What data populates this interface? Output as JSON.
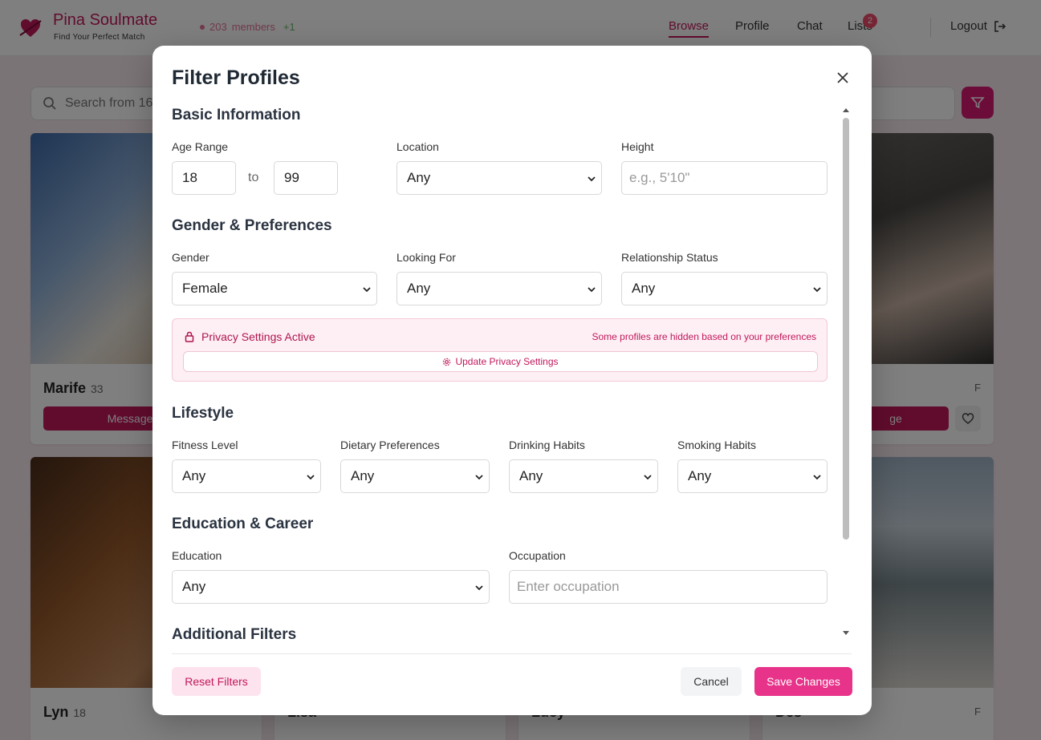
{
  "app": {
    "brand_name": "Pina Soulmate",
    "brand_tagline": "Find Your Perfect Match",
    "members_count": "203",
    "members_label": "members",
    "members_delta": "+1"
  },
  "nav": {
    "browse": "Browse",
    "profile": "Profile",
    "chat": "Chat",
    "lists": "Lists",
    "lists_badge": "2",
    "logout": "Logout"
  },
  "search": {
    "placeholder": "Search from 16"
  },
  "cards": [
    {
      "name": "Marife",
      "age": "33",
      "message": "Message"
    },
    {
      "name": "",
      "age": "",
      "gender": "F",
      "message": "ge"
    },
    {
      "name": "Lyn",
      "age": "18"
    },
    {
      "name": "Lisa",
      "age": ""
    },
    {
      "name": "Lucy",
      "age": ""
    },
    {
      "name": "Des",
      "age": "",
      "gender": "F"
    }
  ],
  "modal": {
    "title": "Filter Profiles",
    "basic": {
      "title": "Basic Information",
      "age_label": "Age Range",
      "age_min": "18",
      "age_to": "to",
      "age_max": "99",
      "location_label": "Location",
      "location_value": "Any",
      "height_label": "Height",
      "height_placeholder": "e.g., 5'10\""
    },
    "gender": {
      "title": "Gender & Preferences",
      "gender_label": "Gender",
      "gender_value": "Female",
      "looking_label": "Looking For",
      "looking_value": "Any",
      "relationship_label": "Relationship Status",
      "relationship_value": "Any"
    },
    "privacy": {
      "title": "Privacy Settings Active",
      "note": "Some profiles are hidden based on your preferences",
      "button": "Update Privacy Settings"
    },
    "lifestyle": {
      "title": "Lifestyle",
      "fitness_label": "Fitness Level",
      "fitness_value": "Any",
      "dietary_label": "Dietary Preferences",
      "dietary_value": "Any",
      "drinking_label": "Drinking Habits",
      "drinking_value": "Any",
      "smoking_label": "Smoking Habits",
      "smoking_value": "Any"
    },
    "education": {
      "title": "Education & Career",
      "education_label": "Education",
      "education_value": "Any",
      "occupation_label": "Occupation",
      "occupation_placeholder": "Enter occupation"
    },
    "additional": {
      "title": "Additional Filters"
    },
    "buttons": {
      "reset": "Reset Filters",
      "cancel": "Cancel",
      "save": "Save Changes"
    }
  },
  "colors": {
    "brand": "#c2185b",
    "primary_button": "#e8338a",
    "reset_bg": "#fde3ee",
    "privacy_bg": "#fdeff4"
  }
}
